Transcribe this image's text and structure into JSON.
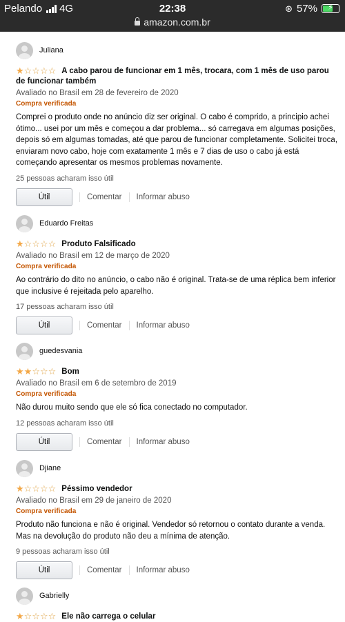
{
  "status": {
    "carrier": "Pelando",
    "network": "4G",
    "time": "22:38",
    "battery": "57%",
    "url": "amazon.com.br"
  },
  "labels": {
    "verified": "Compra verificada",
    "helpful_button": "Útil",
    "comment": "Comentar",
    "report": "Informar abuso"
  },
  "reviews": [
    {
      "name": "Juliana",
      "rating": 1,
      "title": "A cabo parou de funcionar em 1 mês, trocara, com 1 mês de uso parou de funcionar também",
      "date": "Avaliado no Brasil em 28 de fevereiro de 2020",
      "body": "Comprei o produto onde no anúncio diz ser original. O cabo é comprido, a principio achei ótimo... usei por um mês e começou a dar problema... só carregava em algumas posições, depois só em algumas tomadas, até que parou de funcionar completamente. Solicitei troca, enviaram novo cabo, hoje com exatamente 1 mês e 7 dias de uso o cabo já está começando apresentar os mesmos problemas novamente.",
      "helpful": "25 pessoas acharam isso útil"
    },
    {
      "name": "Eduardo Freitas",
      "rating": 1,
      "title": "Produto Falsificado",
      "date": "Avaliado no Brasil em 12 de março de 2020",
      "body": "Ao contrário do dito no anúncio, o cabo não é original. Trata-se de uma réplica bem inferior que inclusive é rejeitada pelo aparelho.",
      "helpful": "17 pessoas acharam isso útil"
    },
    {
      "name": "guedesvania",
      "rating": 2,
      "title": "Bom",
      "date": "Avaliado no Brasil em 6 de setembro de 2019",
      "body": "Não durou muito sendo que ele só fica conectado no computador.",
      "helpful": "12 pessoas acharam isso útil"
    },
    {
      "name": "Djiane",
      "rating": 1,
      "title": "Péssimo vendedor",
      "date": "Avaliado no Brasil em 29 de janeiro de 2020",
      "body": "Produto não funciona e não é original. Vendedor só retornou o contato durante a venda. Mas na devolução do produto não deu a mínima de atenção.",
      "helpful": "9 pessoas acharam isso útil"
    },
    {
      "name": "Gabrielly",
      "rating": 1,
      "title": "Ele não carrega o celular"
    }
  ]
}
